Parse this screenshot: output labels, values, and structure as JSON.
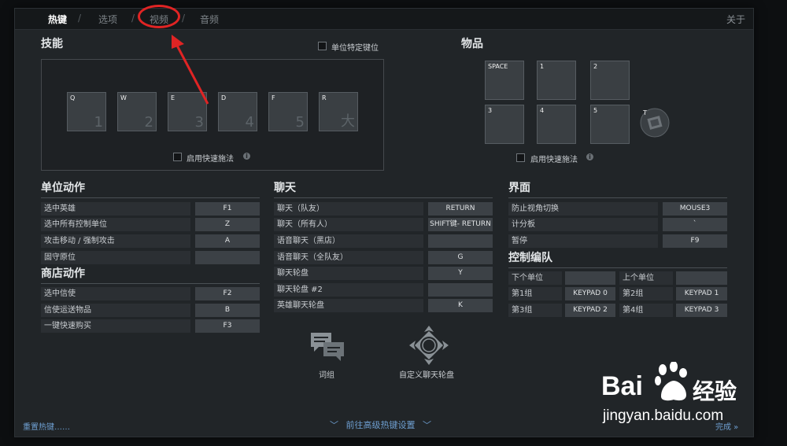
{
  "tabs": [
    {
      "label": "热键",
      "active": true
    },
    {
      "label": "选项",
      "active": false
    },
    {
      "label": "视频",
      "active": false
    },
    {
      "label": "音频",
      "active": false
    }
  ],
  "tab_sep": "/",
  "about": "关于",
  "skills": {
    "title": "技能",
    "unit_specific": "单位特定键位",
    "slots": [
      {
        "key": "Q",
        "num": "1"
      },
      {
        "key": "W",
        "num": "2"
      },
      {
        "key": "E",
        "num": "3"
      },
      {
        "key": "D",
        "num": "4"
      },
      {
        "key": "F",
        "num": "5"
      },
      {
        "key": "R",
        "num": "大"
      }
    ],
    "quickcast": "启用快速施法"
  },
  "items": {
    "title": "物品",
    "slots": [
      "SPACE",
      "1",
      "2",
      "3",
      "4",
      "5"
    ],
    "tp_key": "T",
    "quickcast": "启用快速施法"
  },
  "unit_actions": {
    "title": "单位动作",
    "rows": [
      {
        "label": "选中英雄",
        "key": "F1"
      },
      {
        "label": "选中所有控制单位",
        "key": "Z"
      },
      {
        "label": "攻击移动 / 强制攻击",
        "key": "A"
      },
      {
        "label": "固守原位",
        "key": ""
      }
    ]
  },
  "shop_actions": {
    "title": "商店动作",
    "rows": [
      {
        "label": "选中信使",
        "key": "F2"
      },
      {
        "label": "信使运送物品",
        "key": "B"
      },
      {
        "label": "一键快速购买",
        "key": "F3"
      }
    ]
  },
  "chat": {
    "title": "聊天",
    "rows": [
      {
        "label": "聊天（队友）",
        "key": "RETURN"
      },
      {
        "label": "聊天（所有人）",
        "key": "SHIFT键- RETURN"
      },
      {
        "label": "语音聊天（黑店）",
        "key": ""
      },
      {
        "label": "语音聊天（全队友）",
        "key": "G"
      },
      {
        "label": "聊天轮盘",
        "key": "Y"
      },
      {
        "label": "聊天轮盘 #2",
        "key": ""
      },
      {
        "label": "英雄聊天轮盘",
        "key": "K"
      }
    ],
    "phrases_label": "词组",
    "custom_wheel_label": "自定义聊天轮盘"
  },
  "interface": {
    "title": "界面",
    "rows": [
      {
        "label": "防止视角切换",
        "key": "MOUSE3"
      },
      {
        "label": "计分板",
        "key": "`"
      },
      {
        "label": "暂停",
        "key": "F9"
      }
    ]
  },
  "control_groups": {
    "title": "控制编队",
    "rows": [
      {
        "l1": "下个单位",
        "k1": "",
        "l2": "上个单位",
        "k2": ""
      },
      {
        "l1": "第1组",
        "k1": "KEYPAD 0",
        "l2": "第2组",
        "k2": "KEYPAD 1"
      },
      {
        "l1": "第3组",
        "k1": "KEYPAD 2",
        "l2": "第4组",
        "k2": "KEYPAD 3"
      }
    ]
  },
  "footer": {
    "reset": "重置热键……",
    "advanced": "前往高级热键设置",
    "right_link": "完成 »"
  },
  "watermark": {
    "brand_latin": "Bai",
    "brand_cn": "经验",
    "url": "jingyan.baidu.com"
  },
  "colors": {
    "panel": "#212528",
    "accent_link": "#6e9fd1",
    "highlight_red": "#e02424"
  }
}
